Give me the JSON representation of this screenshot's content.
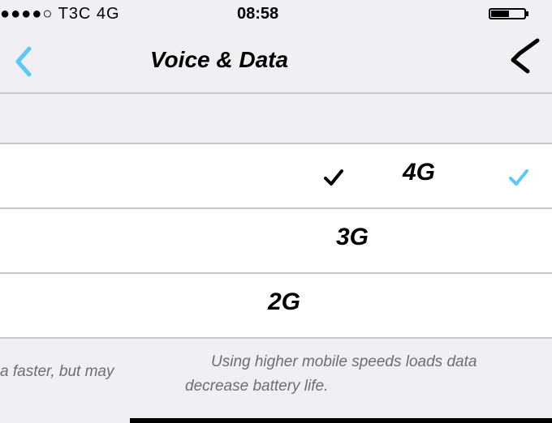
{
  "status_bar": {
    "carrier": "●●●●○ T3C  4G",
    "time": "08:58"
  },
  "nav": {
    "title": "Voice & Data"
  },
  "options": [
    {
      "label": "4G",
      "selected": true
    },
    {
      "label": "3G",
      "selected": false
    },
    {
      "label": "2G",
      "selected": false
    }
  ],
  "footer": {
    "line_left": "a faster, but may",
    "line1": "Using higher mobile speeds loads data",
    "line2": "decrease battery life."
  },
  "colors": {
    "accent": "#5ac8fa",
    "separator": "#c8c7cc",
    "background": "#efeff4"
  }
}
